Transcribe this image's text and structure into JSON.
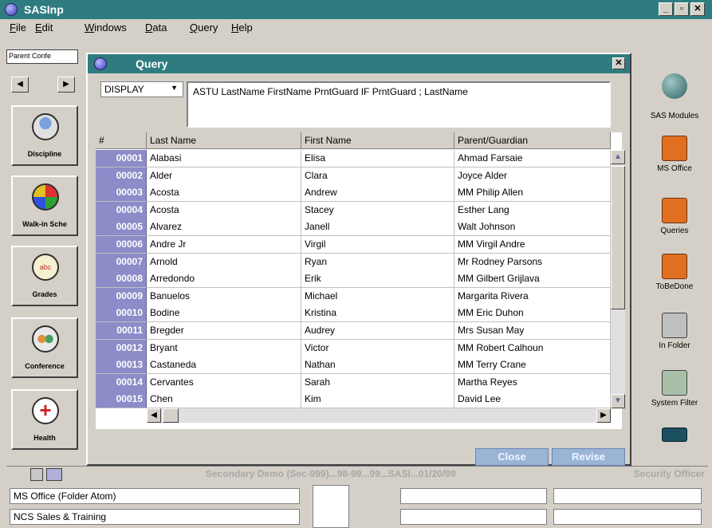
{
  "app": {
    "title": "SASInp"
  },
  "menu": [
    "File",
    "Edit",
    "Windows",
    "Data",
    "Query",
    "Help"
  ],
  "left_panel": {
    "parent_field": "Parent Confe",
    "buttons": [
      {
        "label": "Discipline",
        "icon": "person-icon"
      },
      {
        "label": "Walk-in Sche",
        "icon": "grid-calendar-icon"
      },
      {
        "label": "Grades",
        "icon": "abc-grades-icon"
      },
      {
        "label": "Conference",
        "icon": "conference-people-icon"
      },
      {
        "label": "Health",
        "icon": "health-cross-icon"
      }
    ]
  },
  "right_panel": [
    {
      "label": "SAS Modules",
      "icon": "globe-icon"
    },
    {
      "label": "MS Office",
      "icon": "briefcase-icon"
    },
    {
      "label": "Queries",
      "icon": "briefcase-icon"
    },
    {
      "label": "ToBeDone",
      "icon": "briefcase-icon"
    },
    {
      "label": "In Folder",
      "icon": "inbox-icon"
    },
    {
      "label": "System Filter",
      "icon": "filter-icon"
    },
    {
      "label": "",
      "icon": "device-icon"
    }
  ],
  "query": {
    "title": "Query",
    "mode": "DISPLAY",
    "text": "ASTU  LastName  FirstName PrntGuard IF  PrntGuard ;  LastName",
    "columns": [
      "#",
      "Last Name",
      "First Name",
      "Parent/Guardian"
    ],
    "rows": [
      [
        "00001",
        "Alabasi",
        "Elisa",
        "Ahmad Farsaie"
      ],
      [
        "00002",
        "Alder",
        "Clara",
        "Joyce Alder"
      ],
      [
        "00003",
        "Acosta",
        "Andrew",
        "MM Philip Allen"
      ],
      [
        "00004",
        "Acosta",
        "Stacey",
        "Esther Lang"
      ],
      [
        "00005",
        "Alvarez",
        "Janell",
        "Walt Johnson"
      ],
      [
        "00006",
        "Andre Jr",
        "Virgil",
        "MM Virgil Andre"
      ],
      [
        "00007",
        "Arnold",
        "Ryan",
        "Mr Rodney Parsons"
      ],
      [
        "00008",
        "Arredondo",
        "Erik",
        "MM Gilbert Grijlava"
      ],
      [
        "00009",
        "Banuelos",
        "Michael",
        "Margarita Rivera"
      ],
      [
        "00010",
        "Bodine",
        "Kristina",
        "MM Eric Duhon"
      ],
      [
        "00011",
        "Bregder",
        "Audrey",
        "Mrs Susan May"
      ],
      [
        "00012",
        "Bryant",
        "Victor",
        "MM Robert Calhoun"
      ],
      [
        "00013",
        "Castaneda",
        "Nathan",
        "MM Terry Crane"
      ],
      [
        "00014",
        "Cervantes",
        "Sarah",
        "Martha Reyes"
      ],
      [
        "00015",
        "Chen",
        "Kim",
        "David Lee"
      ]
    ],
    "buttons": {
      "close": "Close",
      "revise": "Revise"
    }
  },
  "status": {
    "center": "Secondary Demo (Sec-999)...98-99...99...SASI...01/20/99",
    "right": "Security Officer"
  },
  "info_fields": [
    "MS Office (Folder Atom)",
    "NCS Sales & Training"
  ],
  "colors": {
    "titlebar": "#2f7c80",
    "row_number_bg": "#8c8cc8",
    "window_bg": "#d4d0c8"
  }
}
